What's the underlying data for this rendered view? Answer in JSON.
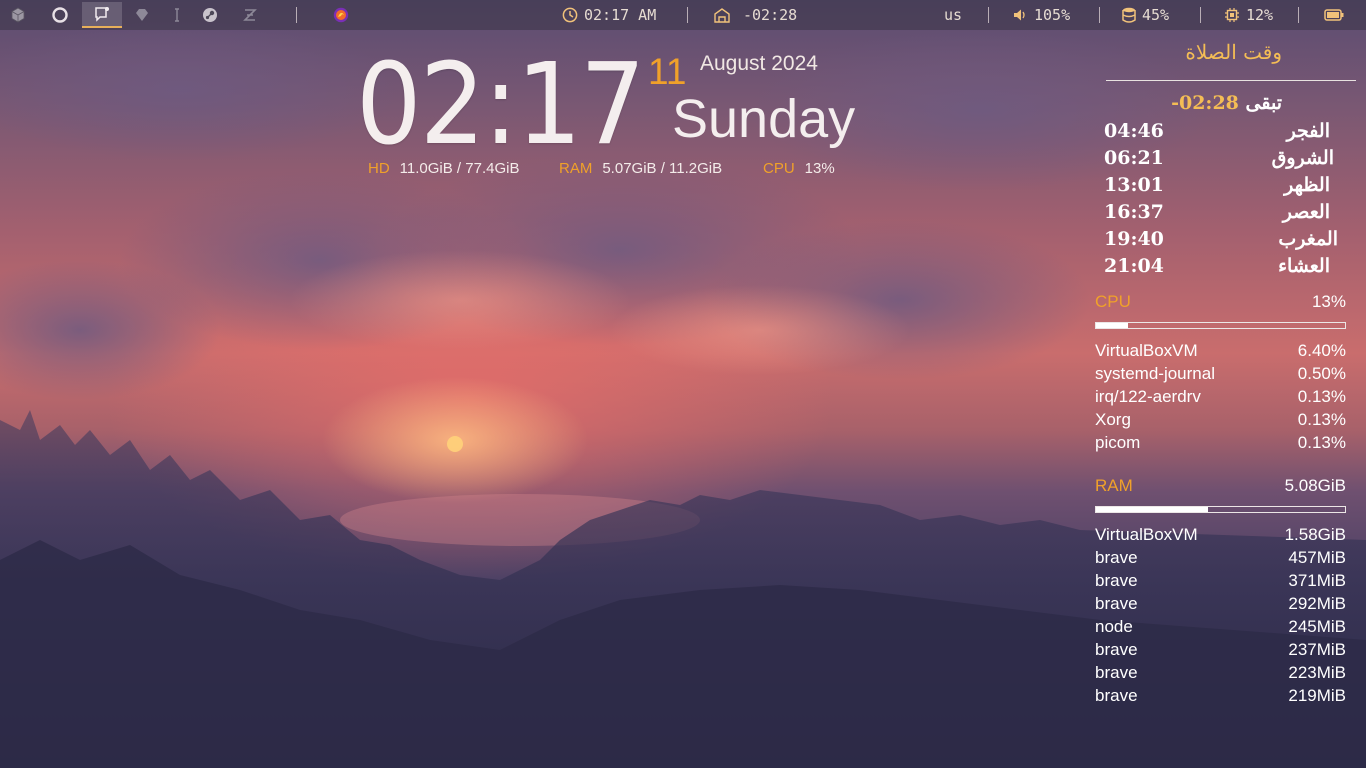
{
  "topbar": {
    "workspaces": [
      {
        "icon": "cube-icon",
        "active": false
      },
      {
        "icon": "opera-icon",
        "active": false
      },
      {
        "icon": "chat-icon",
        "active": true
      },
      {
        "icon": "gem-icon",
        "active": false
      },
      {
        "icon": "text-cursor-icon",
        "active": false
      },
      {
        "icon": "steam-icon",
        "active": false
      },
      {
        "icon": "logo-icon",
        "active": false
      }
    ],
    "tray_app_icon": "firefox-icon",
    "time": "02:17 AM",
    "prayer_countdown": "-02:28",
    "keyboard_layout": "us",
    "volume": "105%",
    "disk": "45%",
    "cpu": "12%",
    "battery_icon": "battery-icon"
  },
  "clock": {
    "time": "02:17",
    "day": "11",
    "month_year": "August 2024",
    "weekday": "Sunday"
  },
  "sysinfo": {
    "hd_label": "HD",
    "hd_value": "11.0GiB / 77.4GiB",
    "ram_label": "RAM",
    "ram_value": "5.07GiB / 11.2GiB",
    "cpu_label": "CPU",
    "cpu_value": "13%"
  },
  "prayer": {
    "title": "وقت الصلاة",
    "remaining_label": "تبقى",
    "remaining_value": "-02:28",
    "times": [
      {
        "name": "الفجر",
        "time": "04:46"
      },
      {
        "name": "الشروق",
        "time": "06:21"
      },
      {
        "name": "الظهر",
        "time": "13:01"
      },
      {
        "name": "العصر",
        "time": "16:37"
      },
      {
        "name": "المغرب",
        "time": "19:40"
      },
      {
        "name": "العشاء",
        "time": "21:04"
      }
    ]
  },
  "cpu_panel": {
    "label": "CPU",
    "value": "13%",
    "usage_fraction": 0.13,
    "processes": [
      {
        "name": "VirtualBoxVM",
        "value": "6.40%"
      },
      {
        "name": "systemd-journal",
        "value": "0.50%"
      },
      {
        "name": "irq/122-aerdrv",
        "value": "0.13%"
      },
      {
        "name": "Xorg",
        "value": "0.13%"
      },
      {
        "name": "picom",
        "value": "0.13%"
      }
    ]
  },
  "ram_panel": {
    "label": "RAM",
    "value": "5.08GiB",
    "usage_fraction": 0.45,
    "processes": [
      {
        "name": "VirtualBoxVM",
        "value": "1.58GiB"
      },
      {
        "name": "brave",
        "value": "457MiB"
      },
      {
        "name": "brave",
        "value": "371MiB"
      },
      {
        "name": "brave",
        "value": "292MiB"
      },
      {
        "name": "node",
        "value": "245MiB"
      },
      {
        "name": "brave",
        "value": "237MiB"
      },
      {
        "name": "brave",
        "value": "223MiB"
      },
      {
        "name": "brave",
        "value": "219MiB"
      }
    ]
  }
}
